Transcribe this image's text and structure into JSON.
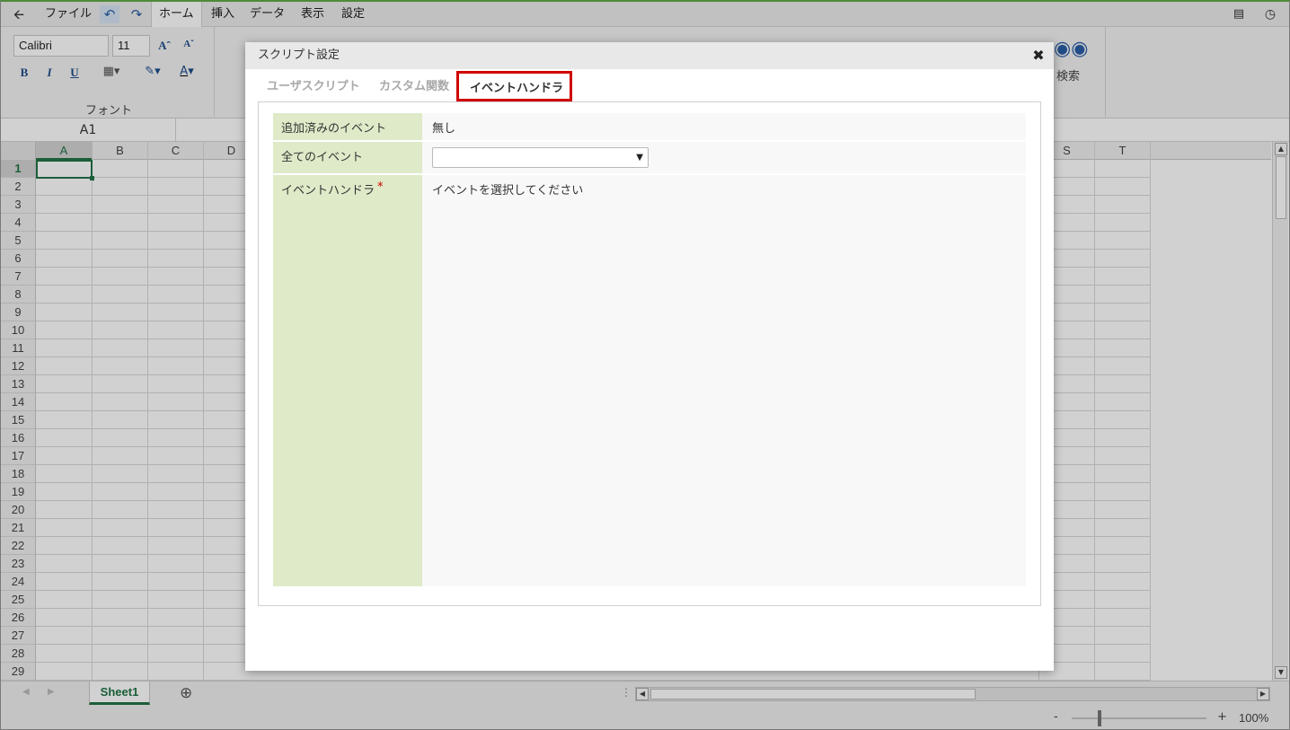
{
  "menubar": {
    "items": [
      "ファイル",
      "ホーム",
      "挿入",
      "データ",
      "表示",
      "設定"
    ]
  },
  "ribbon": {
    "font_name": "Calibri",
    "font_size": "11",
    "font_group_label": "フォント",
    "search_label": "検索"
  },
  "formula": {
    "name_box": "A1"
  },
  "grid": {
    "columns_left": [
      "A",
      "B",
      "C",
      "D"
    ],
    "columns_right": [
      "S",
      "T"
    ],
    "rows": [
      "1",
      "2",
      "3",
      "4",
      "5",
      "6",
      "7",
      "8",
      "9",
      "10",
      "11",
      "12",
      "13",
      "14",
      "15",
      "16",
      "17",
      "18",
      "19",
      "20",
      "21",
      "22",
      "23",
      "24",
      "25",
      "26",
      "27",
      "28",
      "29"
    ]
  },
  "sheet_tabs": [
    "Sheet1"
  ],
  "status": {
    "zoom": "100%",
    "zoom_minus": "-",
    "zoom_plus": "+"
  },
  "dialog": {
    "title": "スクリプト設定",
    "close": "✖",
    "tabs": [
      "ユーザスクリプト",
      "カスタム関数",
      "イベントハンドラ"
    ],
    "active_tab": 2,
    "fields": {
      "added_events_label": "追加済みのイベント",
      "added_events_value": "無し",
      "all_events_label": "全てのイベント",
      "all_events_value": "",
      "handler_label": "イベントハンドラ",
      "handler_required": "*",
      "handler_value": "イベントを選択してください"
    }
  },
  "colors": {
    "label_bg": "#deeac8",
    "highlight_border": "#d00000",
    "excel_green": "#217346"
  }
}
